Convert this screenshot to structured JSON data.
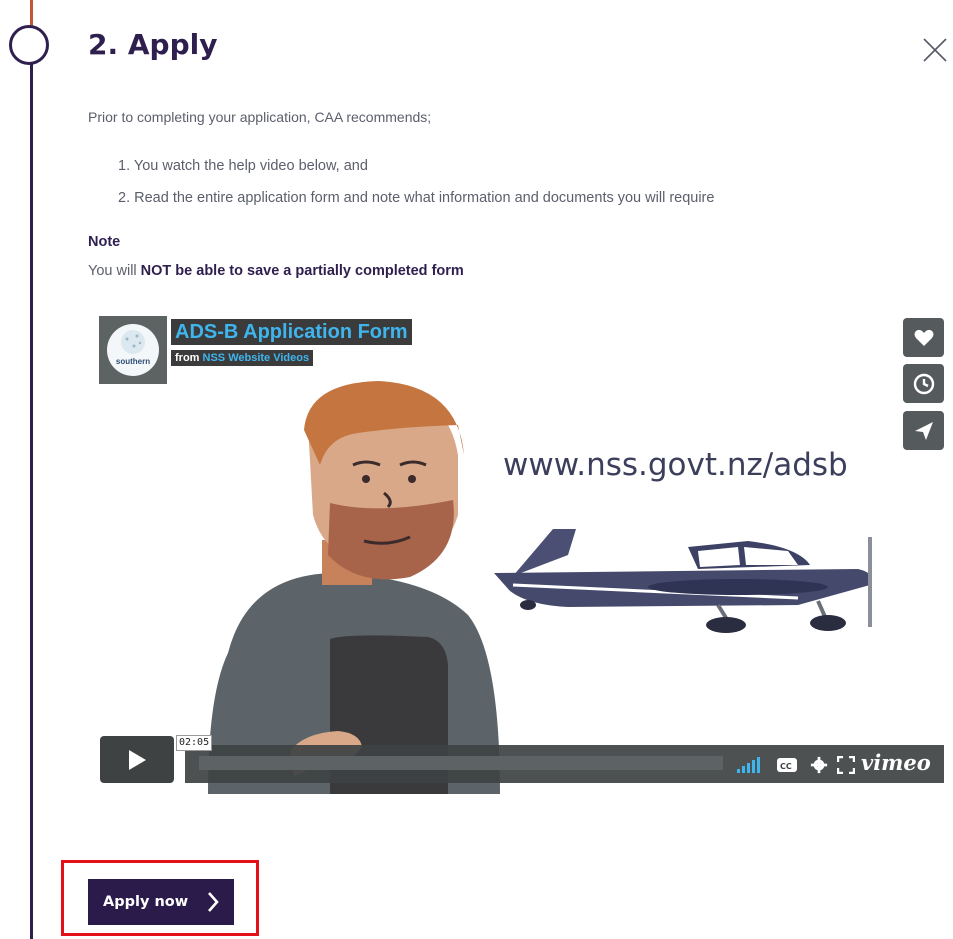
{
  "step": {
    "title": "2. Apply",
    "intro": "Prior to completing your application, CAA recommends;",
    "recommendations": [
      "1. You watch the help video below, and",
      "2. Read the entire application form and note what information and documents you will require"
    ],
    "note_heading": "Note",
    "note_prefix": "You will ",
    "note_bold": "NOT be able to save a partially completed form"
  },
  "video": {
    "title": "ADS-B Application Form",
    "byline_from": "from",
    "byline_channel": "NSS Website Videos",
    "logo_text": "southern",
    "url_text": "www.nss.govt.nz/adsb",
    "time": "02:05",
    "vimeo_label": "vimeo",
    "side_buttons": [
      "heart-icon",
      "clock-icon",
      "send-icon"
    ]
  },
  "actions": {
    "apply_label": "Apply now"
  },
  "colors": {
    "brand": "#2e1f4f",
    "accent_line": "#c0563a",
    "highlight": "#e3101a",
    "video_title": "#3fb5ee"
  }
}
